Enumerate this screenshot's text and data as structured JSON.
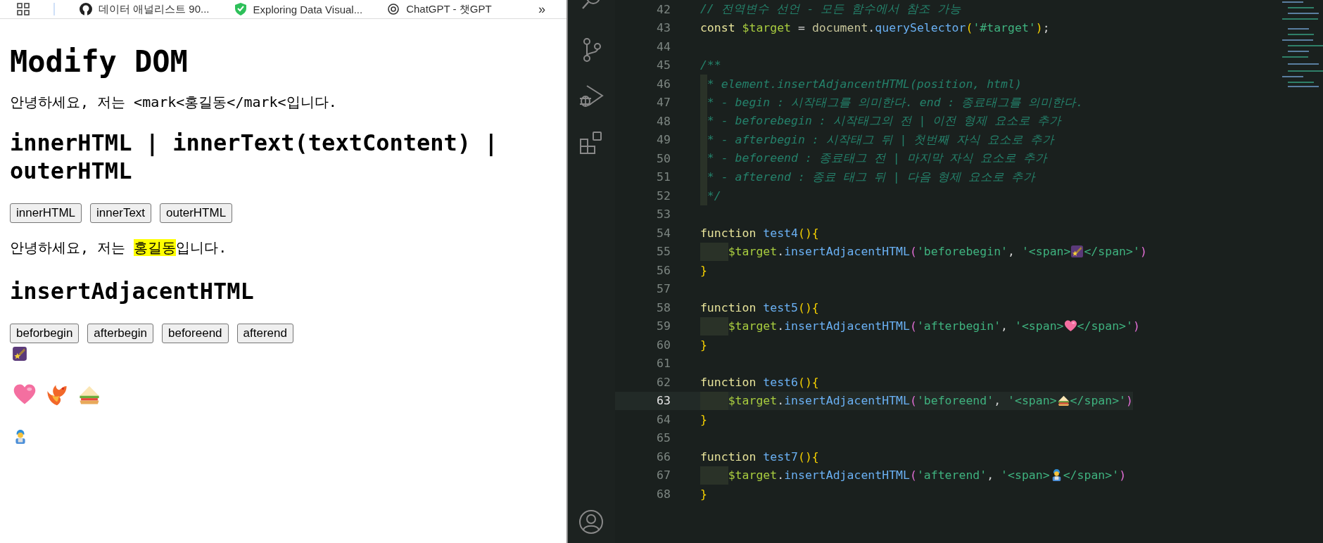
{
  "browser": {
    "bookmarks": [
      {
        "label": "데이터 애널리스트 90..."
      },
      {
        "label": "Exploring Data Visual..."
      },
      {
        "label": "ChatGPT - 챗GPT"
      }
    ],
    "overflow": "»"
  },
  "page": {
    "title": "Modify DOM",
    "intro": "안녕하세요, 저는 <mark<홍길동</mark<입니다.",
    "section1": {
      "heading": "innerHTML | innerText(textContent) | outerHTML",
      "buttons": [
        "innerHTML",
        "innerText",
        "outerHTML"
      ]
    },
    "greeting": {
      "before": "안녕하세요, 저는 ",
      "marked": "홍길동",
      "after": "입니다."
    },
    "section2": {
      "heading": "insertAdjacentHTML",
      "buttons": [
        "beforbegin",
        "afterbegin",
        "beforeend",
        "afterend"
      ]
    }
  },
  "editor": {
    "lines": [
      {
        "num": "42",
        "current": false,
        "tokens": [
          {
            "kind": "comment",
            "text": "// 전역변수 선언 - 모든 함수에서 참조 가능"
          }
        ]
      },
      {
        "num": "43",
        "current": false,
        "tokens": [
          {
            "kind": "keyword",
            "text": "const "
          },
          {
            "kind": "var",
            "text": "$target"
          },
          {
            "kind": "plain",
            "text": " = "
          },
          {
            "kind": "obj",
            "text": "document"
          },
          {
            "kind": "plain",
            "text": "."
          },
          {
            "kind": "func",
            "text": "querySelector"
          },
          {
            "kind": "bracket",
            "text": "("
          },
          {
            "kind": "string",
            "text": "'#target'"
          },
          {
            "kind": "bracket",
            "text": ")"
          },
          {
            "kind": "plain",
            "text": ";"
          }
        ]
      },
      {
        "num": "44",
        "current": false
      },
      {
        "num": "45",
        "current": false,
        "tokens": [
          {
            "kind": "comment",
            "text": "/**"
          }
        ]
      },
      {
        "num": "46",
        "current": false,
        "indented": true,
        "tokens": [
          {
            "kind": "comment",
            "text": "* element.insertAdjancentHTML(position, html)"
          }
        ]
      },
      {
        "num": "47",
        "current": false,
        "indented": true,
        "tokens": [
          {
            "kind": "comment",
            "text": "* - begin : 시작태그를 의미한다. end : 종료태그를 의미한다."
          }
        ]
      },
      {
        "num": "48",
        "current": false,
        "indented": true,
        "tokens": [
          {
            "kind": "comment",
            "text": "* - beforebegin : 시작태그의 전 | 이전 형제 요소로 추가"
          }
        ]
      },
      {
        "num": "49",
        "current": false,
        "indented": true,
        "tokens": [
          {
            "kind": "comment",
            "text": "* - afterbegin : 시작태그 뒤 | 첫번째 자식 요소로 추가"
          }
        ]
      },
      {
        "num": "50",
        "current": false,
        "indented": true,
        "tokens": [
          {
            "kind": "comment",
            "text": "* - beforeend : 종료태그 전 | 마지막 자식 요소로 추가"
          }
        ]
      },
      {
        "num": "51",
        "current": false,
        "indented": true,
        "tokens": [
          {
            "kind": "comment",
            "text": "* - afterend : 종료 태그 뒤 | 다음 형제 요소로 추가"
          }
        ]
      },
      {
        "num": "52",
        "current": false,
        "indented": true,
        "tokens": [
          {
            "kind": "comment",
            "text": "*/"
          }
        ]
      },
      {
        "num": "53",
        "current": false
      },
      {
        "num": "54",
        "current": false,
        "tokens": [
          {
            "kind": "keyword",
            "text": "function "
          },
          {
            "kind": "func",
            "text": "test4"
          },
          {
            "kind": "bracket",
            "text": "(){"
          }
        ]
      },
      {
        "num": "55",
        "current": false,
        "indented": true,
        "tokens": [
          {
            "kind": "var",
            "text": "$target"
          },
          {
            "kind": "plain",
            "text": "."
          },
          {
            "kind": "func",
            "text": "insertAdjacentHTML"
          },
          {
            "kind": "paren",
            "text": "("
          },
          {
            "kind": "string",
            "text": "'beforebegin'"
          },
          {
            "kind": "plain",
            "text": ", "
          },
          {
            "kind": "string",
            "text": "'<span>"
          },
          {
            "kind": "emoji"
          },
          {
            "kind": "string",
            "text": "</span>'"
          },
          {
            "kind": "paren",
            "text": ")"
          }
        ]
      },
      {
        "num": "56",
        "current": false,
        "tokens": [
          {
            "kind": "bracket",
            "text": "}"
          }
        ]
      },
      {
        "num": "57",
        "current": false
      },
      {
        "num": "58",
        "current": false,
        "tokens": [
          {
            "kind": "keyword",
            "text": "function "
          },
          {
            "kind": "func",
            "text": "test5"
          },
          {
            "kind": "bracket",
            "text": "(){"
          }
        ]
      },
      {
        "num": "59",
        "current": false,
        "indented": true,
        "tokens": [
          {
            "kind": "var",
            "text": "$target"
          },
          {
            "kind": "plain",
            "text": "."
          },
          {
            "kind": "func",
            "text": "insertAdjacentHTML"
          },
          {
            "kind": "paren",
            "text": "("
          },
          {
            "kind": "string",
            "text": "'afterbegin'"
          },
          {
            "kind": "plain",
            "text": ", "
          },
          {
            "kind": "string",
            "text": "'<span>"
          },
          {
            "kind": "emoji"
          },
          {
            "kind": "string",
            "text": "</span>'"
          },
          {
            "kind": "paren",
            "text": ")"
          }
        ]
      },
      {
        "num": "60",
        "current": false,
        "tokens": [
          {
            "kind": "bracket",
            "text": "}"
          }
        ]
      },
      {
        "num": "61",
        "current": false
      },
      {
        "num": "62",
        "current": false,
        "tokens": [
          {
            "kind": "keyword",
            "text": "function "
          },
          {
            "kind": "func",
            "text": "test6"
          },
          {
            "kind": "bracket",
            "text": "(){"
          }
        ]
      },
      {
        "num": "63",
        "current": true,
        "indented": true,
        "tokens": [
          {
            "kind": "var",
            "text": "$target"
          },
          {
            "kind": "plain",
            "text": "."
          },
          {
            "kind": "func",
            "text": "insertAdjacentHTML"
          },
          {
            "kind": "paren",
            "text": "("
          },
          {
            "kind": "string",
            "text": "'beforeend'"
          },
          {
            "kind": "plain",
            "text": ", "
          },
          {
            "kind": "string",
            "text": "'<span>"
          },
          {
            "kind": "emoji"
          },
          {
            "kind": "string",
            "text": "</span>'"
          },
          {
            "kind": "paren",
            "text": ")"
          }
        ]
      },
      {
        "num": "64",
        "current": false,
        "tokens": [
          {
            "kind": "bracket",
            "text": "}"
          }
        ]
      },
      {
        "num": "65",
        "current": false
      },
      {
        "num": "66",
        "current": false,
        "tokens": [
          {
            "kind": "keyword",
            "text": "function "
          },
          {
            "kind": "func",
            "text": "test7"
          },
          {
            "kind": "bracket",
            "text": "(){"
          }
        ]
      },
      {
        "num": "67",
        "current": false,
        "indented": true,
        "tokens": [
          {
            "kind": "var",
            "text": "$target"
          },
          {
            "kind": "plain",
            "text": "."
          },
          {
            "kind": "func",
            "text": "insertAdjacentHTML"
          },
          {
            "kind": "paren",
            "text": "("
          },
          {
            "kind": "string",
            "text": "'afterend'"
          },
          {
            "kind": "plain",
            "text": ", "
          },
          {
            "kind": "string",
            "text": "'<span>"
          },
          {
            "kind": "emoji"
          },
          {
            "kind": "string",
            "text": "</span>'"
          },
          {
            "kind": "paren",
            "text": ")"
          }
        ]
      },
      {
        "num": "68",
        "current": false,
        "tokens": [
          {
            "kind": "bracket",
            "text": "}"
          }
        ]
      }
    ]
  }
}
